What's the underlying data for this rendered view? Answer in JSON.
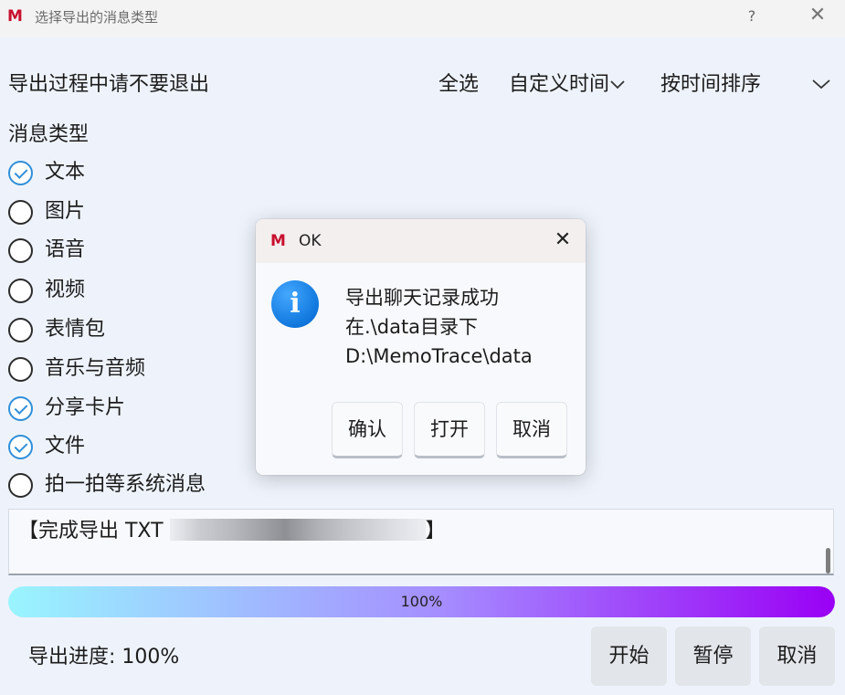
{
  "window": {
    "logo": "M",
    "title": "选择导出的消息类型",
    "help": "?",
    "close": "✕"
  },
  "toolbar": {
    "notice": "导出过程中请不要退出",
    "select_all": "全选",
    "custom_time": "自定义时间",
    "sort_order": "按时间排序"
  },
  "message_types": {
    "title": "消息类型",
    "options": [
      {
        "label": "文本",
        "checked": true
      },
      {
        "label": "图片",
        "checked": false
      },
      {
        "label": "语音",
        "checked": false
      },
      {
        "label": "视频",
        "checked": false
      },
      {
        "label": "表情包",
        "checked": false
      },
      {
        "label": "音乐与音频",
        "checked": false
      },
      {
        "label": "分享卡片",
        "checked": true
      },
      {
        "label": "文件",
        "checked": true
      },
      {
        "label": "拍一拍等系统消息",
        "checked": false
      }
    ]
  },
  "log": {
    "prefix": "【完成导出 TXT ",
    "suffix": "】"
  },
  "progress": {
    "value": 100,
    "text": "100%",
    "status_label": "导出进度: 100%"
  },
  "footer": {
    "start": "开始",
    "pause": "暂停",
    "cancel": "取消"
  },
  "dialog": {
    "logo": "M",
    "title": "OK",
    "close": "✕",
    "icon": "i",
    "lines": [
      "导出聊天记录成功",
      "在.\\data目录下",
      "D:\\MemoTrace\\data"
    ],
    "confirm": "确认",
    "open": "打开",
    "cancel": "取消"
  },
  "colors": {
    "accent": "#2f8fd8",
    "progress_start": "#99f5ff",
    "progress_end": "#9a00f5",
    "logo_red": "#c8102e"
  }
}
